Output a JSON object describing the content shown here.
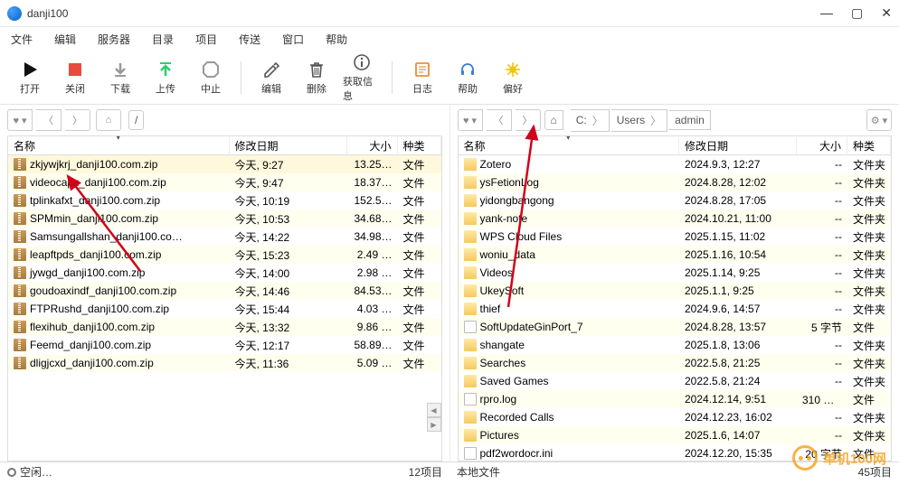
{
  "window": {
    "title": "danji100"
  },
  "menu": [
    "文件",
    "编辑",
    "服务器",
    "目录",
    "项目",
    "传送",
    "窗口",
    "帮助"
  ],
  "toolbar": [
    {
      "id": "open",
      "label": "打开",
      "icon": "play",
      "color": "#111"
    },
    {
      "id": "close",
      "label": "关闭",
      "icon": "stop",
      "color": "#e74c3c"
    },
    {
      "id": "download",
      "label": "下载",
      "icon": "down",
      "color": "#999"
    },
    {
      "id": "upload",
      "label": "上传",
      "icon": "up",
      "color": "#2ecc71"
    },
    {
      "id": "abort",
      "label": "中止",
      "icon": "oct",
      "color": "#999"
    },
    {
      "id": "edit",
      "label": "编辑",
      "icon": "pencil",
      "color": "#555"
    },
    {
      "id": "delete",
      "label": "删除",
      "icon": "trash",
      "color": "#555"
    },
    {
      "id": "info",
      "label": "获取信息",
      "icon": "info",
      "color": "#555"
    },
    {
      "id": "log",
      "label": "日志",
      "icon": "log",
      "color": "#e67e22"
    },
    {
      "id": "help",
      "label": "帮助",
      "icon": "headset",
      "color": "#3b7dd8"
    },
    {
      "id": "prefs",
      "label": "偏好",
      "icon": "gear",
      "color": "#f1c40f"
    }
  ],
  "columns": {
    "name": "名称",
    "date": "修改日期",
    "size": "大小",
    "type": "种类"
  },
  "left": {
    "breadcrumb": [
      "/"
    ],
    "rows": [
      {
        "name": "zkjywjkrj_danji100.com.zip",
        "date": "今天, 9:27",
        "size": "13.25…",
        "type": "文件",
        "icon": "zip",
        "sel": true
      },
      {
        "name": "videocapx_danji100.com.zip",
        "date": "今天, 9:47",
        "size": "18.37…",
        "type": "文件",
        "icon": "zip"
      },
      {
        "name": "tplinkafxt_danji100.com.zip",
        "date": "今天, 10:19",
        "size": "152.5…",
        "type": "文件",
        "icon": "zip"
      },
      {
        "name": "SPMmin_danji100.com.zip",
        "date": "今天, 10:53",
        "size": "34.68…",
        "type": "文件",
        "icon": "zip"
      },
      {
        "name": "Samsungallshan_danji100.co…",
        "date": "今天, 14:22",
        "size": "34.98…",
        "type": "文件",
        "icon": "zip"
      },
      {
        "name": "leapftpds_danji100.com.zip",
        "date": "今天, 15:23",
        "size": "2.49 …",
        "type": "文件",
        "icon": "zip"
      },
      {
        "name": "jywgd_danji100.com.zip",
        "date": "今天, 14:00",
        "size": "2.98 …",
        "type": "文件",
        "icon": "zip"
      },
      {
        "name": "goudoaxindf_danji100.com.zip",
        "date": "今天, 14:46",
        "size": "84.53…",
        "type": "文件",
        "icon": "zip"
      },
      {
        "name": "FTPRushd_danji100.com.zip",
        "date": "今天, 15:44",
        "size": "4.03 …",
        "type": "文件",
        "icon": "zip"
      },
      {
        "name": "flexihub_danji100.com.zip",
        "date": "今天, 13:32",
        "size": "9.86 …",
        "type": "文件",
        "icon": "zip"
      },
      {
        "name": "Feemd_danji100.com.zip",
        "date": "今天, 12:17",
        "size": "58.89…",
        "type": "文件",
        "icon": "zip"
      },
      {
        "name": "dligjcxd_danji100.com.zip",
        "date": "今天, 11:36",
        "size": "5.09 …",
        "type": "文件",
        "icon": "zip"
      }
    ],
    "status_left": "空闲…",
    "status_right": "12项目"
  },
  "right": {
    "breadcrumb": [
      "C:",
      "Users",
      "admin"
    ],
    "rows": [
      {
        "name": "Zotero",
        "date": "2024.9.3, 12:27",
        "size": "--",
        "type": "文件夹",
        "icon": "folder"
      },
      {
        "name": "ysFetionLog",
        "date": "2024.8.28, 12:02",
        "size": "--",
        "type": "文件夹",
        "icon": "folder"
      },
      {
        "name": "yidongbangong",
        "date": "2024.8.28, 17:05",
        "size": "--",
        "type": "文件夹",
        "icon": "folder"
      },
      {
        "name": "yank-note",
        "date": "2024.10.21, 11:00",
        "size": "--",
        "type": "文件夹",
        "icon": "folder"
      },
      {
        "name": "WPS Cloud Files",
        "date": "2025.1.15, 11:02",
        "size": "--",
        "type": "文件夹",
        "icon": "folder"
      },
      {
        "name": "woniu_data",
        "date": "2025.1.16, 10:54",
        "size": "--",
        "type": "文件夹",
        "icon": "folder"
      },
      {
        "name": "Videos",
        "date": "2025.1.14, 9:25",
        "size": "--",
        "type": "文件夹",
        "icon": "folder"
      },
      {
        "name": "UkeySoft",
        "date": "2025.1.1, 9:25",
        "size": "--",
        "type": "文件夹",
        "icon": "folder"
      },
      {
        "name": "thief",
        "date": "2024.9.6, 14:57",
        "size": "--",
        "type": "文件夹",
        "icon": "folder"
      },
      {
        "name": "SoftUpdateGinPort_7",
        "date": "2024.8.28, 13:57",
        "size": "5 字节",
        "type": "文件",
        "icon": "file"
      },
      {
        "name": "shangate",
        "date": "2025.1.8, 13:06",
        "size": "--",
        "type": "文件夹",
        "icon": "folder"
      },
      {
        "name": "Searches",
        "date": "2022.5.8, 21:25",
        "size": "--",
        "type": "文件夹",
        "icon": "folder"
      },
      {
        "name": "Saved Games",
        "date": "2022.5.8, 21:24",
        "size": "--",
        "type": "文件夹",
        "icon": "folder"
      },
      {
        "name": "rpro.log",
        "date": "2024.12.14, 9:51",
        "size": "310 千…",
        "type": "文件",
        "icon": "file"
      },
      {
        "name": "Recorded Calls",
        "date": "2024.12.23, 16:02",
        "size": "--",
        "type": "文件夹",
        "icon": "folder"
      },
      {
        "name": "Pictures",
        "date": "2025.1.6, 14:07",
        "size": "--",
        "type": "文件夹",
        "icon": "folder"
      },
      {
        "name": "pdf2wordocr.ini",
        "date": "2024.12.20, 15:35",
        "size": "20 字节",
        "type": "文件",
        "icon": "file"
      }
    ],
    "status_left": "本地文件",
    "status_right": "45项目"
  },
  "watermark": "单机100网"
}
